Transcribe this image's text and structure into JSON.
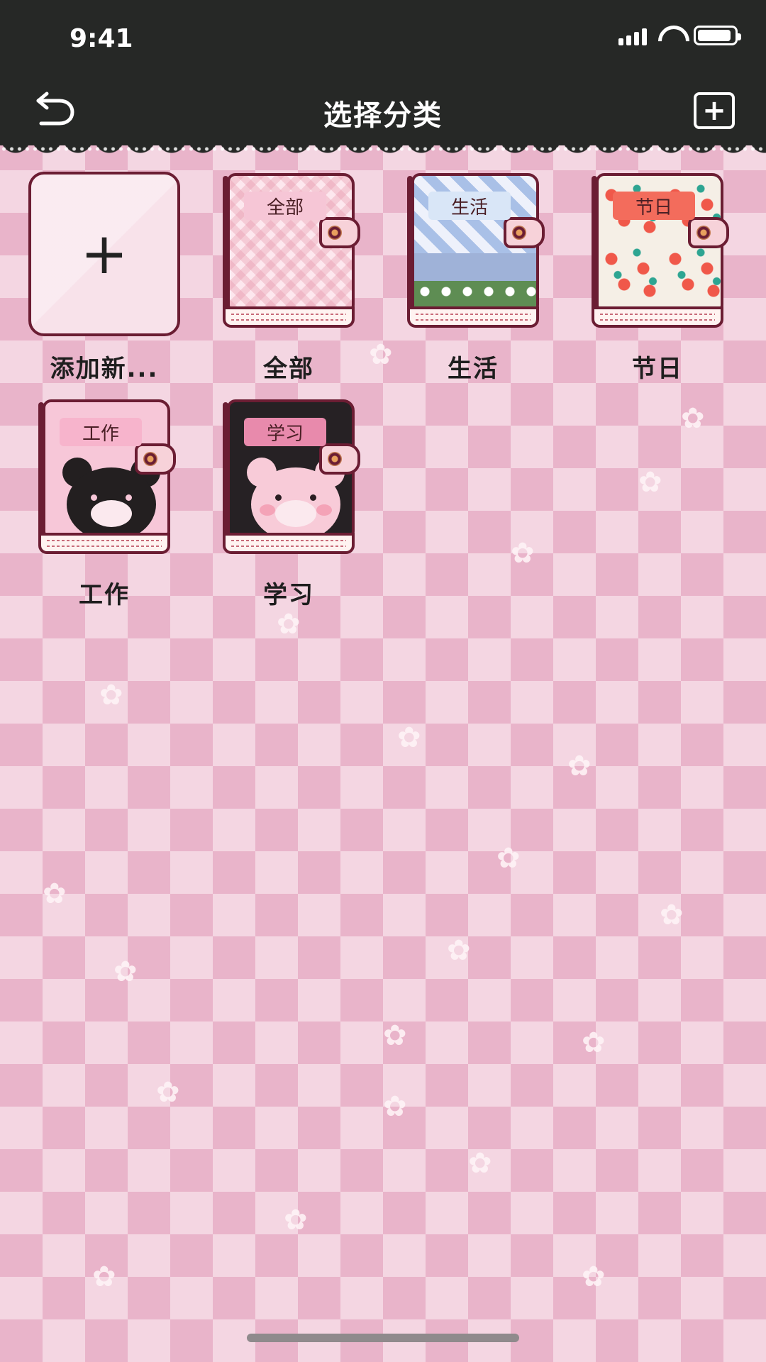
{
  "status_bar": {
    "time": "9:41"
  },
  "header": {
    "title": "选择分类"
  },
  "add_new": {
    "label": "添加新...",
    "symbol": "+"
  },
  "categories": [
    {
      "name": "全部",
      "cover_label": "全部",
      "label_bg": "#f6c6d6"
    },
    {
      "name": "生活",
      "cover_label": "生活",
      "label_bg": "#d9e6f7"
    },
    {
      "name": "节日",
      "cover_label": "节日",
      "label_bg": "#f36c5c"
    },
    {
      "name": "工作",
      "cover_label": "工作",
      "label_bg": "#f7b4cc"
    },
    {
      "name": "学习",
      "cover_label": "学习",
      "label_bg": "#e88aac"
    }
  ],
  "icons": {
    "back": "undo-arrow-icon",
    "add": "plus-square-icon",
    "signal": "cellular-signal-icon",
    "wifi": "wifi-icon",
    "battery": "battery-icon"
  },
  "colors": {
    "header_bg": "#262826",
    "background_light": "#f4d6e2",
    "background_dark": "#e9b4ca",
    "book_outline": "#6b1d33"
  }
}
